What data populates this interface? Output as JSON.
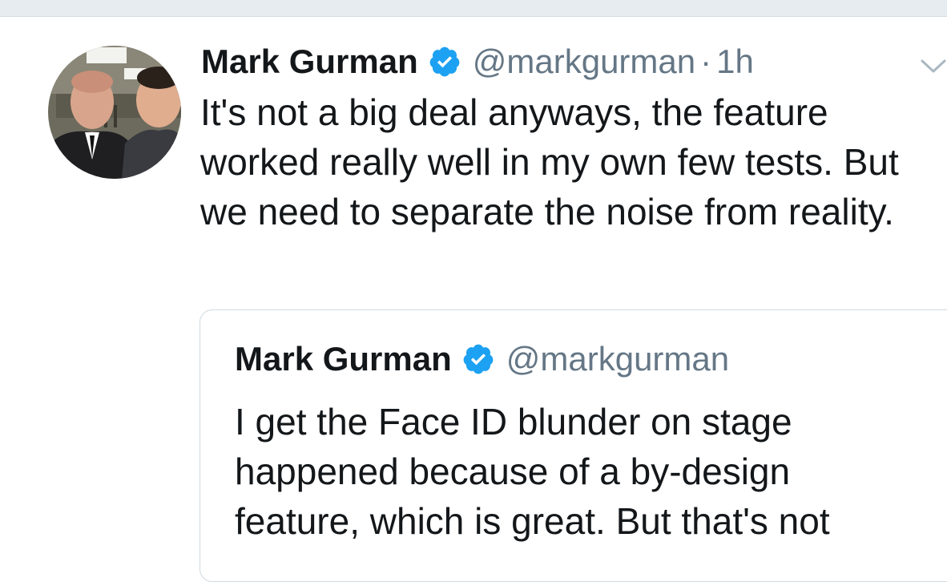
{
  "tweet": {
    "author_name": "Mark Gurman",
    "handle": "@markgurman",
    "separator": "·",
    "time": "1h",
    "text": "It's not a big deal anyways, the feature worked really well in my own few tests. But we need to separate the noise from reality.",
    "verified_icon": "verified-badge-icon",
    "menu_icon": "chevron-down-icon"
  },
  "quoted_tweet": {
    "author_name": "Mark Gurman",
    "handle": "@markgurman",
    "text": "I get the Face ID blunder on stage happened because of a by-design feature, which is great. But that's not",
    "verified_icon": "verified-badge-icon"
  },
  "colors": {
    "verified_blue": "#1da1f2",
    "text_primary": "#14171a",
    "text_secondary": "#657786",
    "border": "#cfd9de"
  }
}
